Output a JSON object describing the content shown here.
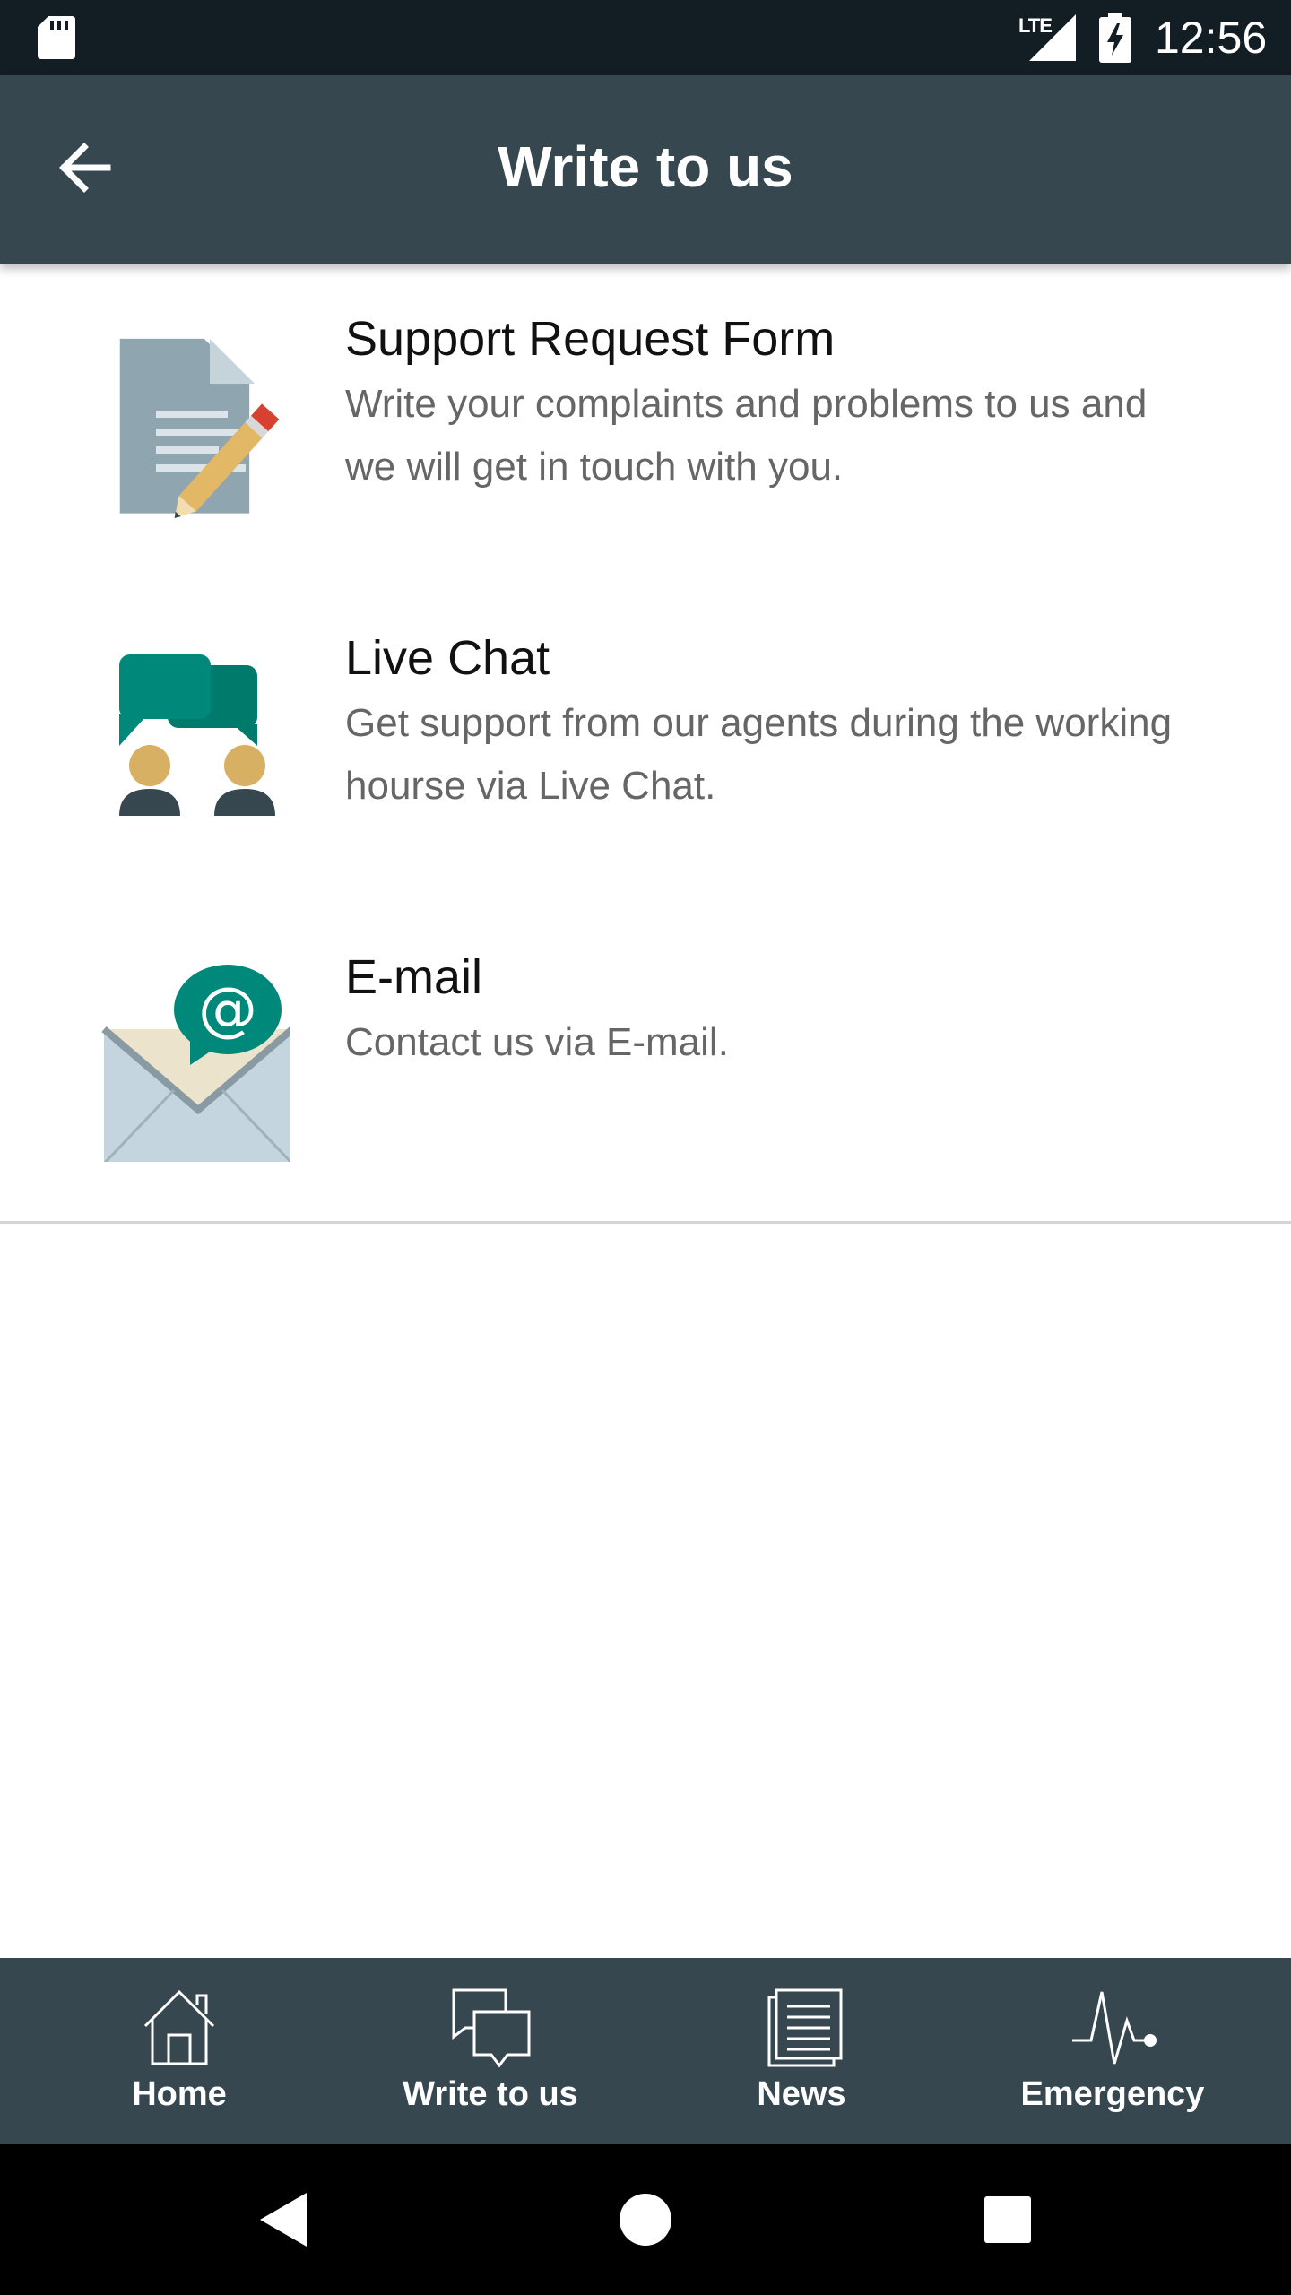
{
  "status_bar": {
    "time": "12:56",
    "network": "LTE"
  },
  "app_bar": {
    "title": "Write to us",
    "back_icon": "arrow-back-icon"
  },
  "items": [
    {
      "title": "Support Request Form",
      "description": "Write your complaints and problems to us and we will get in touch with you.",
      "icon": "document-pencil-icon"
    },
    {
      "title": "Live Chat",
      "description": "Get support from our agents during the working hourse via Live Chat.",
      "icon": "chat-agents-icon"
    },
    {
      "title": "E-mail",
      "description": "Contact us via E-mail.",
      "icon": "email-envelope-icon"
    }
  ],
  "bottom_nav": [
    {
      "label": "Home",
      "icon": "home-icon"
    },
    {
      "label": "Write to us",
      "icon": "chat-bubbles-icon"
    },
    {
      "label": "News",
      "icon": "newspaper-icon"
    },
    {
      "label": "Emergency",
      "icon": "heartbeat-icon"
    }
  ],
  "colors": {
    "app_bar": "#37474f",
    "status_bar": "#131d24",
    "accent": "#00897b"
  }
}
